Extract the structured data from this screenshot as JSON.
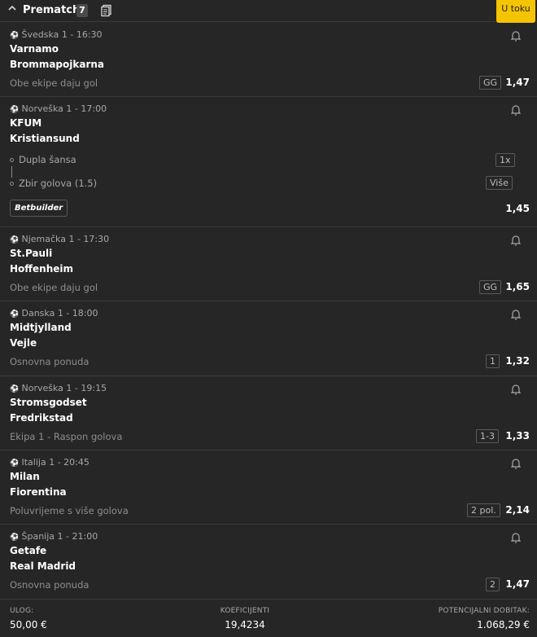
{
  "header": {
    "title": "Prematch",
    "count": "7",
    "live_tab": "U toku"
  },
  "bets": [
    {
      "league": "Švedska 1 - 16:30",
      "home": "Varnamo",
      "away": "Brommapojkarna",
      "market": "Obe ekipe daju gol",
      "pick": "GG",
      "odd": "1,47"
    },
    {
      "league": "Norveška 1 - 17:00",
      "home": "KFUM",
      "away": "Kristiansund",
      "builder": [
        {
          "market": "Dupla šansa",
          "pick": "1x"
        },
        {
          "market": "Zbir golova (1.5)",
          "pick": "Više"
        }
      ],
      "builder_label": "Betbuilder",
      "odd": "1,45"
    },
    {
      "league": "Njemačka 1 - 17:30",
      "home": "St.Pauli",
      "away": "Hoffenheim",
      "market": "Obe ekipe daju gol",
      "pick": "GG",
      "odd": "1,65"
    },
    {
      "league": "Danska 1 - 18:00",
      "home": "Midtjylland",
      "away": "Vejle",
      "market": "Osnovna ponuda",
      "pick": "1",
      "odd": "1,32"
    },
    {
      "league": "Norveška 1 - 19:15",
      "home": "Stromsgodset",
      "away": "Fredrikstad",
      "market": "Ekipa 1 - Raspon golova",
      "pick": "1-3",
      "odd": "1,33"
    },
    {
      "league": "Italija 1 - 20:45",
      "home": "Milan",
      "away": "Fiorentina",
      "market": "Poluvrijeme s više golova",
      "pick": "2 pol.",
      "odd": "2,14"
    },
    {
      "league": "Španija 1 - 21:00",
      "home": "Getafe",
      "away": "Real Madrid",
      "market": "Osnovna ponuda",
      "pick": "2",
      "odd": "1,47"
    }
  ],
  "footer": {
    "stake_label": "ULOG:",
    "stake_value": "50,00 €",
    "odds_label": "KOEFICIJENTI",
    "odds_value": "19,4234",
    "win_label": "POTENCIJALNI DOBITAK:",
    "win_value": "1.068,29 €"
  },
  "colors": {
    "background": "#262626",
    "accent": "#f5c400",
    "text_muted": "#a8a8a8"
  }
}
